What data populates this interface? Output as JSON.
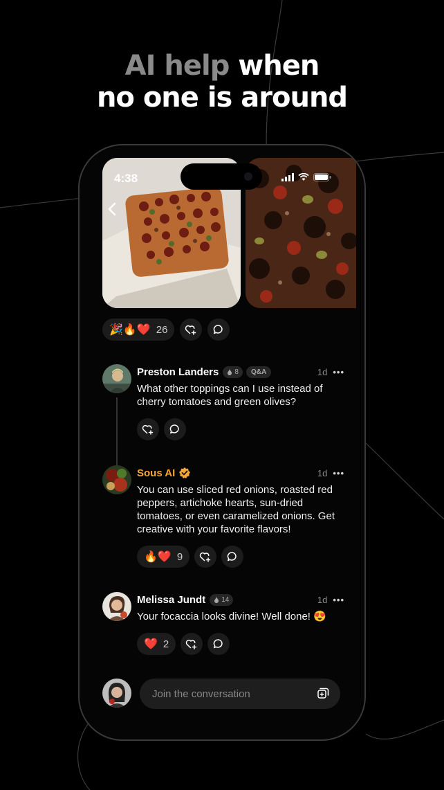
{
  "headline": {
    "dim": "AI help",
    "bright": " when",
    "line2": "no one is around"
  },
  "status_bar": {
    "time": "4:38"
  },
  "post_reactions": {
    "emojis": "🎉🔥❤️",
    "count": "26"
  },
  "comments": [
    {
      "name": "Preston Landers",
      "badge": "8",
      "tag": "Q&A",
      "time": "1d",
      "text": "What other toppings can I use instead of cherry tomatoes and green olives?"
    },
    {
      "name": "Sous AI",
      "verified": true,
      "time": "1d",
      "text": "You can use sliced red onions, roasted red peppers, artichoke hearts, sun-dried tomatoes, or even caramelized onions. Get creative with your favorite flavors!",
      "reaction_emojis": "🔥❤️",
      "reaction_count": "9"
    },
    {
      "name": "Melissa Jundt",
      "badge": "14",
      "time": "1d",
      "text": "Your focaccia looks divine! Well done! 😍",
      "reaction_emojis": "❤️",
      "reaction_count": "2"
    }
  ],
  "composer": {
    "placeholder": "Join the conversation"
  },
  "colors": {
    "ai_name": "#f3a53a",
    "verified": "#f3a53a",
    "background": "#000000"
  }
}
